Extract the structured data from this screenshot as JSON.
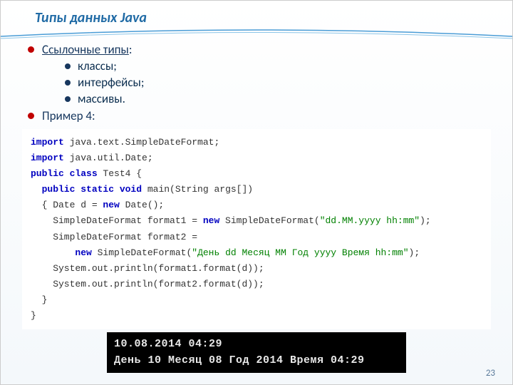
{
  "slide": {
    "title": "Типы данных Java",
    "page_number": "23"
  },
  "bullets": {
    "header": "Ссылочные типы",
    "colon": ":",
    "items": [
      "классы;",
      "интерфейсы;",
      "массивы."
    ],
    "example_label": "Пример 4:"
  },
  "code": {
    "l1a": "import",
    "l1b": " java.text.SimpleDateFormat;",
    "l2a": "import",
    "l2b": " java.util.Date;",
    "l3a": "public class",
    "l3b": " Test4 {",
    "l4a": "  public static ",
    "l4b": "void",
    "l4c": " main(String args[])",
    "l5a": "  { Date d = ",
    "l5b": "new",
    "l5c": " Date();",
    "l6a": "    SimpleDateFormat format1 = ",
    "l6b": "new",
    "l6c": " SimpleDateFormat(",
    "l6d": "\"dd.MM.yyyy hh:mm\"",
    "l6e": ");",
    "l7": "    SimpleDateFormat format2 =",
    "l8a": "        ",
    "l8b": "new",
    "l8c": " SimpleDateFormat(",
    "l8d": "\"День dd Месяц MM Год yyyy Время hh:mm\"",
    "l8e": ");",
    "l9": "    System.out.println(format1.format(d));",
    "l10": "    System.out.println(format2.format(d));",
    "l11": "  }",
    "l12": "}"
  },
  "console": {
    "line1": "10.08.2014 04:29",
    "line2": "День 10 Месяц 08 Год 2014 Время 04:29"
  }
}
